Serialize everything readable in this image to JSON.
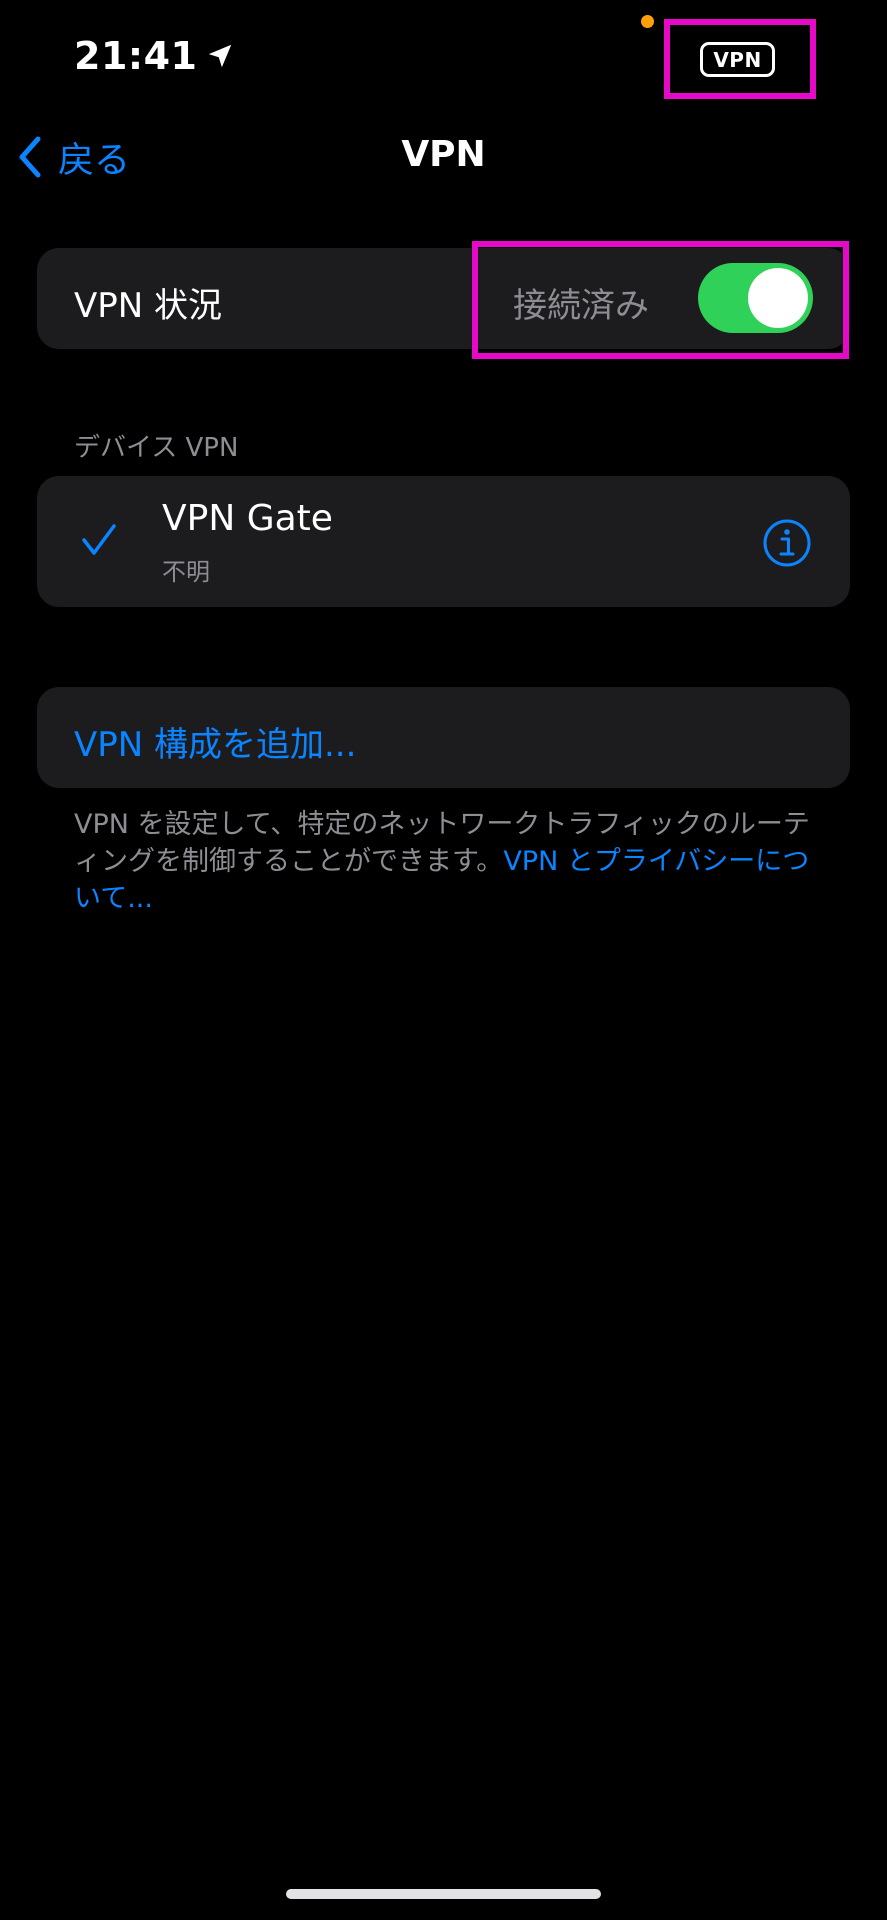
{
  "status_bar": {
    "time": "21:41",
    "vpn_badge": "VPN",
    "location_icon": "location-arrow-icon",
    "dot_color": "#ff9f0a"
  },
  "nav": {
    "back_label": "戻る",
    "back_icon": "chevron-left-icon",
    "title": "VPN"
  },
  "vpn_status": {
    "label": "VPN 状況",
    "value": "接続済み",
    "toggle_on": true
  },
  "device_vpn": {
    "header": "デバイス VPN",
    "items": [
      {
        "name": "VPN Gate",
        "subtitle": "不明",
        "selected": true,
        "info_icon": "info-circle-icon"
      }
    ]
  },
  "add_config": {
    "label": "VPN 構成を追加..."
  },
  "footer": {
    "text": "VPN を設定して、特定のネットワークトラフィックのルーティングを制御することができます。",
    "link": "VPN とプライバシーについて..."
  },
  "colors": {
    "accent": "#0a84ff",
    "toggle_on": "#30d158",
    "highlight": "#e60ac8",
    "cell_bg": "#1c1c1e",
    "secondary_text": "#8d8d93"
  }
}
